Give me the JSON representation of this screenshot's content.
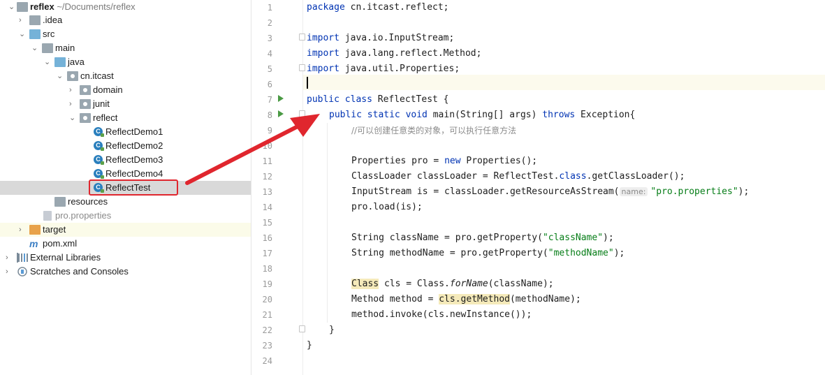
{
  "tree": {
    "root": {
      "name": "reflex",
      "path": "~/Documents/reflex"
    },
    "idea": ".idea",
    "src": "src",
    "main": "main",
    "java": "java",
    "package": "cn.itcast",
    "domain": "domain",
    "junit": "junit",
    "reflect": "reflect",
    "classes": [
      "ReflectDemo1",
      "ReflectDemo2",
      "ReflectDemo3",
      "ReflectDemo4",
      "ReflectTest"
    ],
    "resources": "resources",
    "properties_file": "pro.properties",
    "target": "target",
    "pom": "pom.xml",
    "external_libraries": "External Libraries",
    "scratches": "Scratches and Consoles",
    "class_icon_letter": "C",
    "maven_icon_letter": "m"
  },
  "editor": {
    "line_numbers": [
      "1",
      "2",
      "3",
      "4",
      "5",
      "6",
      "7",
      "8",
      "9",
      "10",
      "11",
      "12",
      "13",
      "14",
      "15",
      "16",
      "17",
      "18",
      "19",
      "20",
      "21",
      "22",
      "23",
      "24"
    ],
    "l1_kw": "package",
    "l1_rest": " cn.itcast.reflect;",
    "l3_kw": "import",
    "l3_rest": " java.io.InputStream;",
    "l4_kw": "import",
    "l4_rest": " java.lang.reflect.Method;",
    "l5_kw": "import",
    "l5_rest": " java.util.Properties;",
    "l7_kw": "public class",
    "l7_rest": " ReflectTest {",
    "l8_kw1": "public static void",
    "l8_mid": " main(String[] args) ",
    "l8_kw2": "throws",
    "l8_rest": " Exception{",
    "l9_comment": "//可以创建任意类的对象，可以执行任意方法",
    "l11_a": "Properties pro = ",
    "l11_kw": "new",
    "l11_b": " Properties();",
    "l12_a": "ClassLoader classLoader = ReflectTest.",
    "l12_kw": "class",
    "l12_b": ".getClassLoader();",
    "l13_a": "InputStream is = classLoader.getResourceAsStream(",
    "l13_hint": "name:",
    "l13_str": "\"pro.properties\"",
    "l13_b": ");",
    "l14": "pro.load(is);",
    "l16_a": "String className = pro.getProperty(",
    "l16_str": "\"className\"",
    "l16_b": ");",
    "l17_a": "String methodName = pro.getProperty(",
    "l17_str": "\"methodName\"",
    "l17_b": ");",
    "l19_a": "Class",
    "l19_b": " cls = Class.",
    "l19_it": "forName",
    "l19_c": "(className);",
    "l20_a": "Method method = ",
    "l20_hl": "cls.getMethod",
    "l20_b": "(methodName);",
    "l21": "method.invoke(cls.newInstance());",
    "l22": "}",
    "l23": "}"
  },
  "colors": {
    "keyword": "#0033b3",
    "string": "#067d17",
    "comment": "#8c8c8c",
    "annotation_arrow": "#e0262e",
    "selection": "#d9d9d9"
  }
}
